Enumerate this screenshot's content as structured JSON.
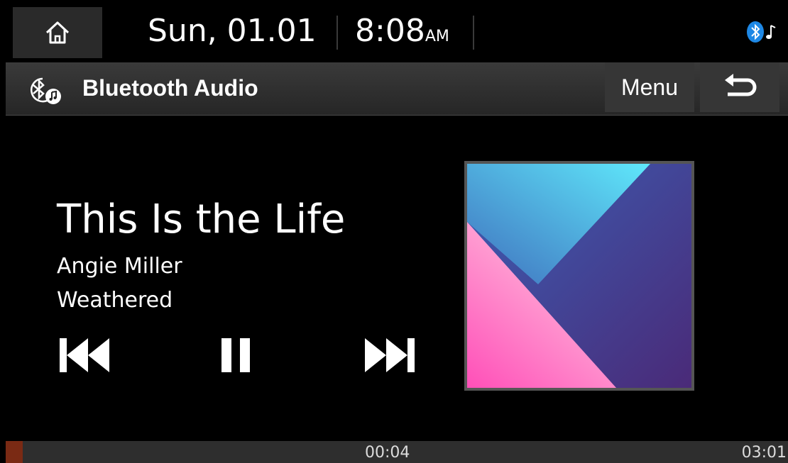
{
  "status_bar": {
    "date": "Sun, 01.01",
    "time": "8:08",
    "ampm": "AM",
    "bt_music_icon": "bluetooth-music-icon"
  },
  "title_bar": {
    "title": "Bluetooth Audio",
    "icon": "bluetooth-audio-icon",
    "menu_label": "Menu",
    "back_icon": "back-arrow-icon"
  },
  "track": {
    "title": "This Is the Life",
    "artist": "Angie Miller",
    "album": "Weathered"
  },
  "controls": {
    "prev_icon": "previous-track-icon",
    "pause_icon": "pause-icon",
    "next_icon": "next-track-icon"
  },
  "progress": {
    "elapsed": "00:04",
    "total": "03:01",
    "fraction": 0.022
  },
  "colors": {
    "accent": "#7a2a14",
    "button_bg": "#363636",
    "background": "#000000"
  }
}
